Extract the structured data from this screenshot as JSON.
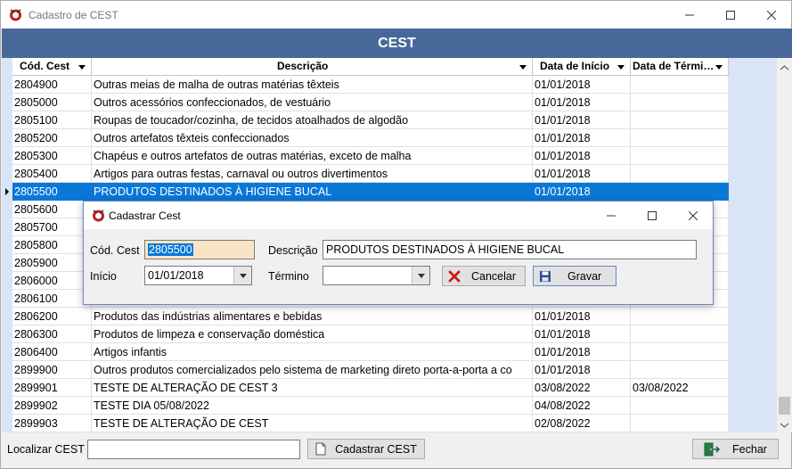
{
  "window": {
    "title": "Cadastro de CEST"
  },
  "header": {
    "title": "CEST"
  },
  "grid": {
    "columns": [
      "Cód. Cest",
      "Descrição",
      "Data de Início",
      "Data de Térmi…"
    ],
    "rows": [
      [
        "2804900",
        "Outras meias de malha de outras matérias têxteis",
        "01/01/2018",
        ""
      ],
      [
        "2805000",
        "Outros acessórios confeccionados, de vestuário",
        "01/01/2018",
        ""
      ],
      [
        "2805100",
        "Roupas de toucador/cozinha, de tecidos atoalhados de algodão",
        "01/01/2018",
        ""
      ],
      [
        "2805200",
        "Outros artefatos têxteis confeccionados",
        "01/01/2018",
        ""
      ],
      [
        "2805300",
        "Chapéus e outros artefatos de outras matérias, exceto de malha",
        "01/01/2018",
        ""
      ],
      [
        "2805400",
        "Artigos para outras festas, carnaval ou outros divertimentos",
        "01/01/2018",
        ""
      ],
      [
        "2805500",
        "PRODUTOS DESTINADOS À HIGIENE BUCAL",
        "01/01/2018",
        ""
      ],
      [
        "2805600",
        "",
        "",
        ""
      ],
      [
        "2805700",
        "",
        "",
        ""
      ],
      [
        "2805800",
        "",
        "",
        ""
      ],
      [
        "2805900",
        "",
        "",
        ""
      ],
      [
        "2806000",
        "",
        "",
        ""
      ],
      [
        "2806100",
        "",
        "",
        ""
      ],
      [
        "2806200",
        "Produtos das indústrias alimentares e bebidas",
        "01/01/2018",
        ""
      ],
      [
        "2806300",
        "Produtos de limpeza e conservação doméstica",
        "01/01/2018",
        ""
      ],
      [
        "2806400",
        "Artigos infantis",
        "01/01/2018",
        ""
      ],
      [
        "2899900",
        "Outros produtos comercializados pelo sistema de marketing direto porta-a-porta a co",
        "01/01/2018",
        ""
      ],
      [
        "2899901",
        "TESTE DE ALTERAÇÃO DE CEST 3",
        "03/08/2022",
        "03/08/2022"
      ],
      [
        "2899902",
        "TESTE DIA 05/08/2022",
        "04/08/2022",
        ""
      ],
      [
        "2899903",
        "TESTE DE ALTERAÇÃO DE CEST",
        "02/08/2022",
        ""
      ]
    ],
    "selected_index": 6
  },
  "bottom": {
    "search_label": "Localizar CEST",
    "search_value": "",
    "add_button": "Cadastrar CEST",
    "close_button": "Fechar"
  },
  "dialog": {
    "title": "Cadastrar Cest",
    "cod_label": "Cód. Cest",
    "cod_value": "2805500",
    "desc_label": "Descrição",
    "desc_value": "PRODUTOS DESTINADOS À HIGIENE BUCAL",
    "inicio_label": "Início",
    "inicio_value": "01/01/2018",
    "termino_label": "Término",
    "termino_value": "",
    "cancel_button": "Cancelar",
    "save_button": "Gravar"
  },
  "colors": {
    "header": "#49689a",
    "selection": "#0a78d7",
    "grid_bg": "#d9e4f6"
  }
}
